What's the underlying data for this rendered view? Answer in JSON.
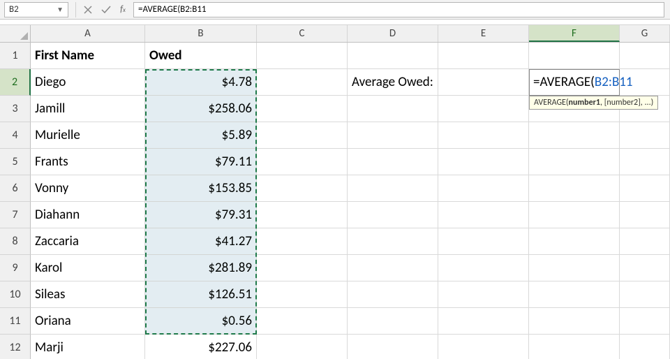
{
  "name_box": "B2",
  "formula_bar": "=AVERAGE(B2:B11",
  "columns": [
    "A",
    "B",
    "C",
    "D",
    "E",
    "F",
    "G"
  ],
  "row_numbers": [
    1,
    2,
    3,
    4,
    5,
    6,
    7,
    8,
    9,
    10,
    11,
    12
  ],
  "headers": {
    "A": "First Name",
    "B": "Owed"
  },
  "data": {
    "A": [
      "Diego",
      "Jamill",
      "Murielle",
      "Frants",
      "Vonny",
      "Diahann",
      "Zaccaria",
      "Karol",
      "Sileas",
      "Oriana",
      "Marji"
    ],
    "B": [
      "$4.78",
      "$258.06",
      "$5.89",
      "$79.11",
      "$153.85",
      "$79.31",
      "$41.27",
      "$281.89",
      "$126.51",
      "$0.56",
      "$227.06"
    ]
  },
  "label_D2": "Average Owed:",
  "editing_cell": {
    "prefix": "=AVERAGE(",
    "range": "B2:B11"
  },
  "tooltip": {
    "fn": "AVERAGE",
    "arg1": "number1",
    "rest": ", [number2], ...)"
  },
  "active_col": "F",
  "active_row": 2,
  "chart_data": {
    "type": "table",
    "columns": [
      "First Name",
      "Owed"
    ],
    "rows": [
      [
        "Diego",
        4.78
      ],
      [
        "Jamill",
        258.06
      ],
      [
        "Murielle",
        5.89
      ],
      [
        "Frants",
        79.11
      ],
      [
        "Vonny",
        153.85
      ],
      [
        "Diahann",
        79.31
      ],
      [
        "Zaccaria",
        41.27
      ],
      [
        "Karol",
        281.89
      ],
      [
        "Sileas",
        126.51
      ],
      [
        "Oriana",
        0.56
      ],
      [
        "Marji",
        227.06
      ]
    ]
  }
}
